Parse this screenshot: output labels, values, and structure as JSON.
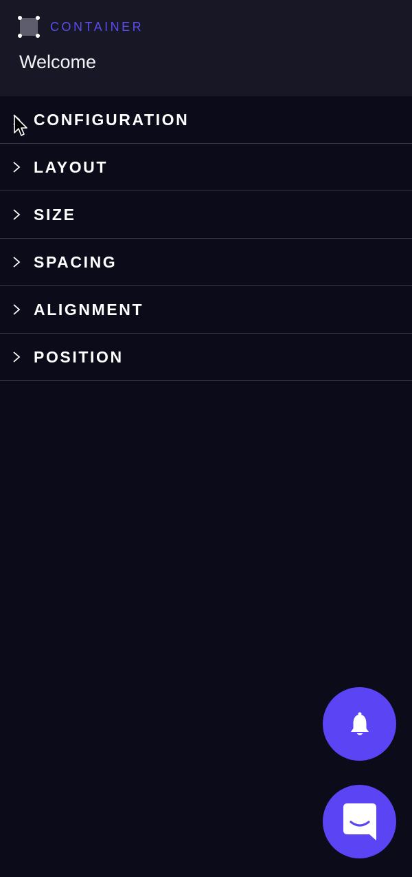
{
  "panel": {
    "element_type_label": "CONTAINER",
    "element_type_icon": "container-icon",
    "element_name": "Welcome",
    "accent_color": "#5b4cf0"
  },
  "sections": [
    {
      "label": "CONFIGURATION",
      "icon": "chevron-right-icon"
    },
    {
      "label": "LAYOUT",
      "icon": "chevron-right-icon"
    },
    {
      "label": "SIZE",
      "icon": "chevron-right-icon"
    },
    {
      "label": "SPACING",
      "icon": "chevron-right-icon"
    },
    {
      "label": "ALIGNMENT",
      "icon": "chevron-right-icon"
    },
    {
      "label": "POSITION",
      "icon": "chevron-right-icon"
    }
  ],
  "floating_buttons": [
    {
      "icon": "bell-icon",
      "color": "#5b44f4"
    },
    {
      "icon": "chat-icon",
      "color": "#5b44f4"
    }
  ]
}
